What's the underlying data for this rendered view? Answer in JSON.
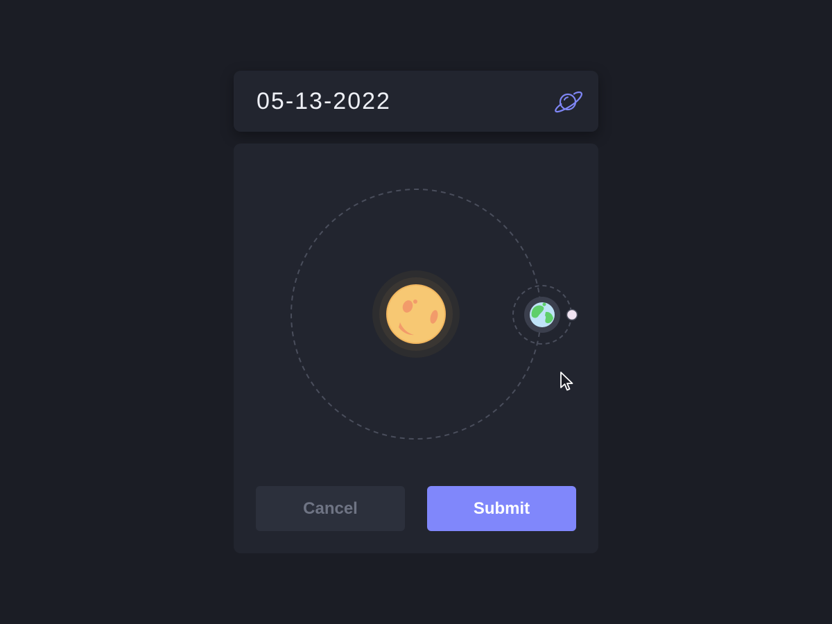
{
  "date_field": {
    "value": "05-13-2022",
    "icon": "planet-icon"
  },
  "visual": {
    "sun_icon": "sun",
    "earth_icon": "earth",
    "moon_icon": "moon"
  },
  "actions": {
    "cancel_label": "Cancel",
    "submit_label": "Submit"
  },
  "colors": {
    "background": "#1b1d25",
    "card": "#22252f",
    "accent": "#8087fb",
    "sun": "#f7c873",
    "earth_land": "#5fcf6b",
    "earth_water": "#bfe3f7"
  }
}
